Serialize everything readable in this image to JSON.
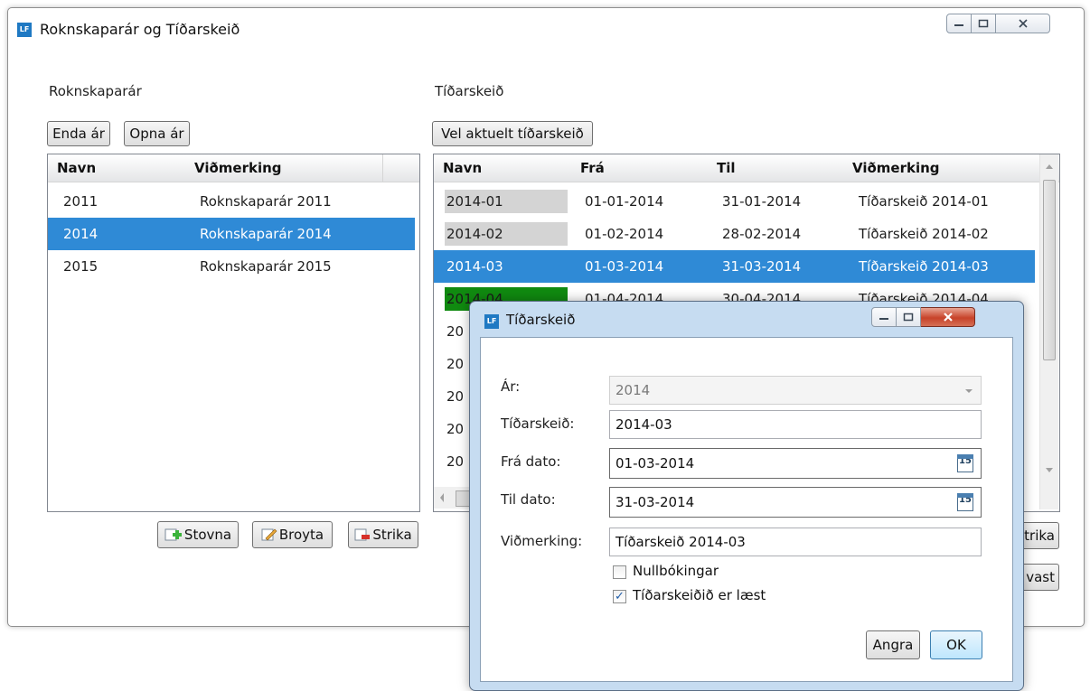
{
  "app": {
    "logo": "LF",
    "title": "Roknskaparár og Tíðarskeið"
  },
  "years_panel": {
    "label": "Roknskaparár",
    "buttons": {
      "end_year": "Enda ár",
      "open_year": "Opna ár"
    },
    "columns": [
      "Navn",
      "Viðmerking"
    ],
    "rows": [
      {
        "name": "2011",
        "note": "Roknskaparár 2011"
      },
      {
        "name": "2014",
        "note": "Roknskaparár 2014"
      },
      {
        "name": "2015",
        "note": "Roknskaparár 2015"
      }
    ],
    "selected_index": 1,
    "actions": {
      "create": "Stovna",
      "edit": "Broyta",
      "delete": "Strika"
    }
  },
  "periods_panel": {
    "label": "Tíðarskeið",
    "buttons": {
      "select_current": "Vel aktuelt tíðarskeið"
    },
    "columns": [
      "Navn",
      "Frá",
      "Til",
      "Viðmerking"
    ],
    "rows": [
      {
        "name": "2014-01",
        "from": "01-01-2014",
        "to": "31-01-2014",
        "note": "Tíðarskeið 2014-01",
        "status": "closed"
      },
      {
        "name": "2014-02",
        "from": "01-02-2014",
        "to": "28-02-2014",
        "note": "Tíðarskeið 2014-02",
        "status": "closed"
      },
      {
        "name": "2014-03",
        "from": "01-03-2014",
        "to": "31-03-2014",
        "note": "Tíðarskeið 2014-03",
        "status": "selected"
      },
      {
        "name": "2014-04",
        "from": "01-04-2014",
        "to": "30-04-2014",
        "note": "Tíðarskeið 2014-04",
        "status": "current"
      },
      {
        "name": "20",
        "from": "",
        "to": "",
        "note": ""
      },
      {
        "name": "20",
        "from": "",
        "to": "",
        "note": ""
      },
      {
        "name": "20",
        "from": "",
        "to": "",
        "note": ""
      },
      {
        "name": "20",
        "from": "",
        "to": "",
        "note": ""
      },
      {
        "name": "20",
        "from": "",
        "to": "",
        "note": ""
      }
    ],
    "actions": {
      "delete_partial": "trika",
      "fix_partial": "vast"
    },
    "status_colors": {
      "closed": "#d4d4d4",
      "current": "#108a10",
      "selected": "#2f8ad6"
    }
  },
  "dialog": {
    "logo": "LF",
    "title": "Tíðarskeið",
    "fields": {
      "year": {
        "label": "Ár:",
        "value": "2014"
      },
      "period": {
        "label": "Tíðarskeið:",
        "value": "2014-03"
      },
      "from_date": {
        "label": "Frá dato:",
        "value": "01-03-2014"
      },
      "to_date": {
        "label": "Til dato:",
        "value": "31-03-2014"
      },
      "note": {
        "label": "Viðmerking:",
        "value": "Tíðarskeið 2014-03"
      }
    },
    "calendar_day": "15",
    "checkboxes": {
      "zero_bookings": {
        "label": "Nullbókingar",
        "checked": false
      },
      "locked": {
        "label": "Tíðarskeiðið er læst",
        "checked": true
      }
    },
    "buttons": {
      "cancel": "Angra",
      "ok": "OK"
    }
  }
}
